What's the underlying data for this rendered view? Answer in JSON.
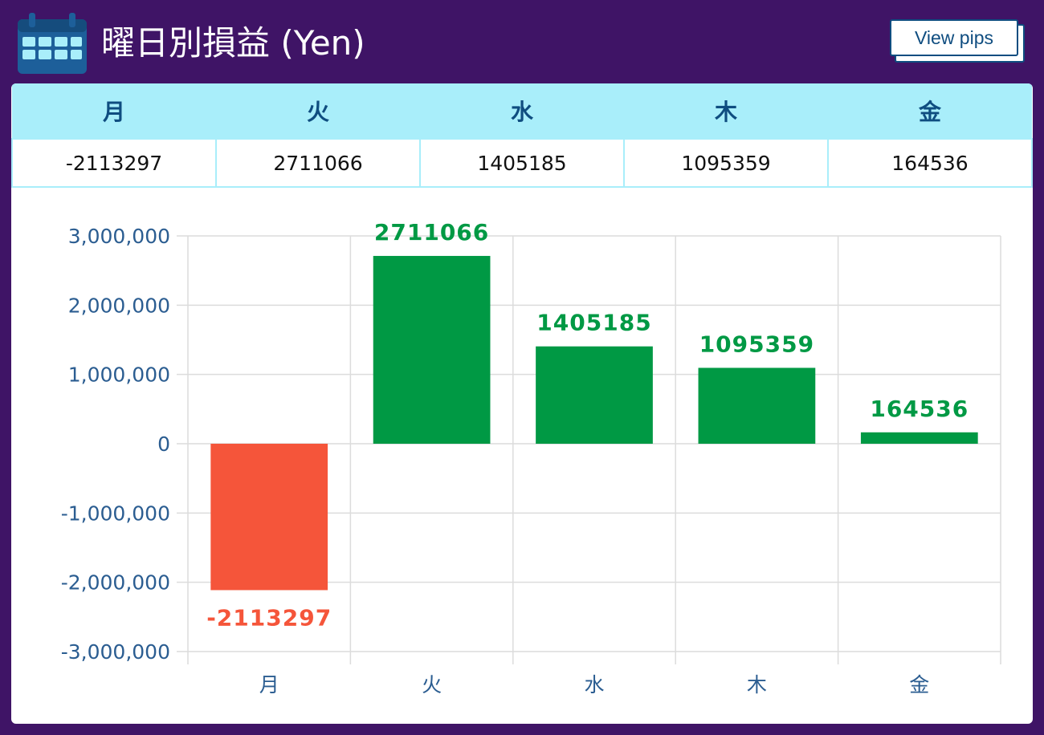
{
  "header": {
    "title": "曜日別損益 (Yen)",
    "icon": "calendar-icon",
    "pips_button_label": "View pips"
  },
  "summary_table": {
    "headers": [
      "月",
      "火",
      "水",
      "木",
      "金"
    ],
    "values": [
      "-2113297",
      "2711066",
      "1405185",
      "1095359",
      "164536"
    ]
  },
  "colors": {
    "background": "#3f1466",
    "header_row": "#a9eefa",
    "positive": "#009944",
    "negative": "#f5553a",
    "axis_text": "#2b5d91"
  },
  "chart_data": {
    "type": "bar",
    "categories": [
      "月",
      "火",
      "水",
      "木",
      "金"
    ],
    "values": [
      -2113297,
      2711066,
      1405185,
      1095359,
      164536
    ],
    "data_labels": [
      "-2113297",
      "2711066",
      "1405185",
      "1095359",
      "164536"
    ],
    "y_ticks": [
      "3,000,000",
      "2,000,000",
      "1,000,000",
      "0",
      "-1,000,000",
      "-2,000,000",
      "-3,000,000"
    ],
    "ylim": [
      -3000000,
      3000000
    ],
    "title": "",
    "xlabel": "",
    "ylabel": "",
    "grid": true,
    "legend": "none"
  }
}
